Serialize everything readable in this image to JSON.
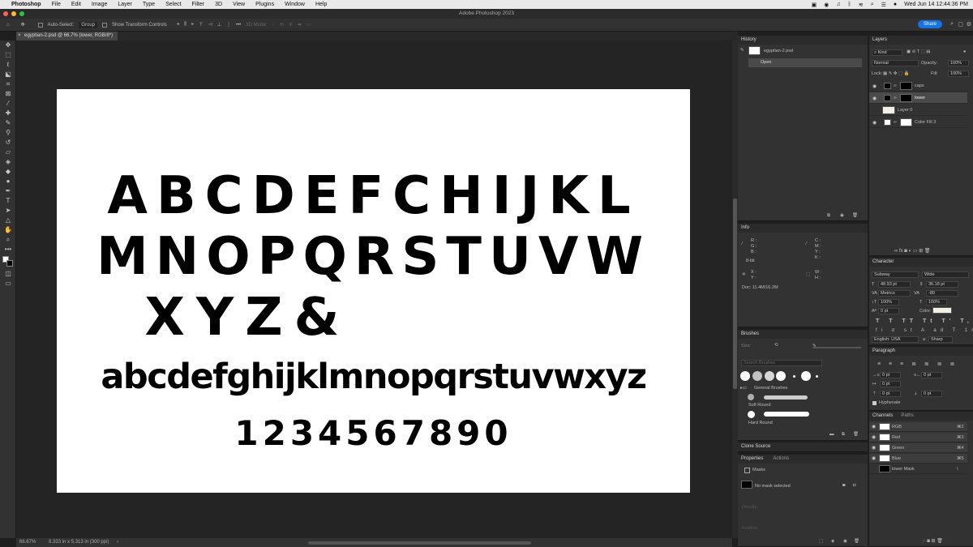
{
  "menubar": {
    "app": "Photoshop",
    "items": [
      "File",
      "Edit",
      "Image",
      "Layer",
      "Type",
      "Select",
      "Filter",
      "3D",
      "View",
      "Plugins",
      "Window",
      "Help"
    ],
    "clock": "Wed Jun 14  12:44:36 PM"
  },
  "window": {
    "title": "Adobe Photoshop 2023"
  },
  "options": {
    "auto_select_label": "Auto-Select:",
    "auto_select_value": "Group",
    "show_transform": "Show Transform Controls",
    "mode3d": "3D Mode:",
    "share": "Share"
  },
  "document": {
    "tab": "egyptian-2.psd @ 66.7% (lower, RGB/8*)",
    "rows": [
      "ABCDEFCHIJKL",
      "MNOPQRSTUVW",
      "XYZ&",
      "abcdefghijklmnopqrstuvwxyz",
      "1234567890"
    ],
    "zoom": "66.67%",
    "size": "8.333 in x 5.313 in (300 ppi)",
    "arrow": "›"
  },
  "history": {
    "title": "History",
    "snapshot": "egyptian-2.psd",
    "step": "Open"
  },
  "info": {
    "title": "Info",
    "r": "R :",
    "g": "G :",
    "b": "B :",
    "bits": "8-bit",
    "x": "X :",
    "y": "Y :",
    "c": "C :",
    "m": "M :",
    "yk": "Y :",
    "k": "K :",
    "w": "W :",
    "h": "H :",
    "doc": "Doc: 11.4M/16.2M"
  },
  "brushes": {
    "title": "Brushes",
    "size_label": "Size:",
    "search_placeholder": "Search Brushes",
    "group": "General Brushes",
    "b1": "Soft Round",
    "b2": "Hard Round"
  },
  "clone": {
    "title": "Clone Source"
  },
  "properties": {
    "tab1": "Properties",
    "tab2": "Actions",
    "masks": "Masks",
    "no_mask": "No mask selected",
    "density": "Density:",
    "feather": "Feather:"
  },
  "layers": {
    "title": "Layers",
    "kind": "Kind",
    "blend": "Normal",
    "opacity_label": "Opacity:",
    "opacity": "100%",
    "lock": "Lock:",
    "fill_label": "Fill:",
    "fill": "100%",
    "rows": [
      {
        "name": "caps"
      },
      {
        "name": "lower"
      },
      {
        "name": "Layer 0"
      },
      {
        "name": "Color Fill 3"
      }
    ]
  },
  "character": {
    "title": "Character",
    "font": "Subway",
    "style": "Wide",
    "size": "48.93 pt",
    "leading": "36.18 pt",
    "kerning": "Metrics",
    "tracking": "-80",
    "vscale": "100%",
    "hscale": "100%",
    "baseline": "0 pt",
    "color_label": "Color:",
    "lang": "English: USA",
    "aa": "Sharp",
    "aa_label": "a"
  },
  "paragraph": {
    "title": "Paragraph",
    "indent1": "0 pt",
    "indent2": "0 pt",
    "indent3": "0 pt",
    "space1": "0 pt",
    "space2": "0 pt",
    "hyphenate": "Hyphenate"
  },
  "channels": {
    "tab1": "Channels",
    "tab2": "Paths",
    "rows": [
      {
        "name": "RGB",
        "key": "⌘2"
      },
      {
        "name": "Red",
        "key": "⌘3"
      },
      {
        "name": "Green",
        "key": "⌘4"
      },
      {
        "name": "Blue",
        "key": "⌘5"
      },
      {
        "name": "lower Mask",
        "key": "\\"
      }
    ]
  }
}
